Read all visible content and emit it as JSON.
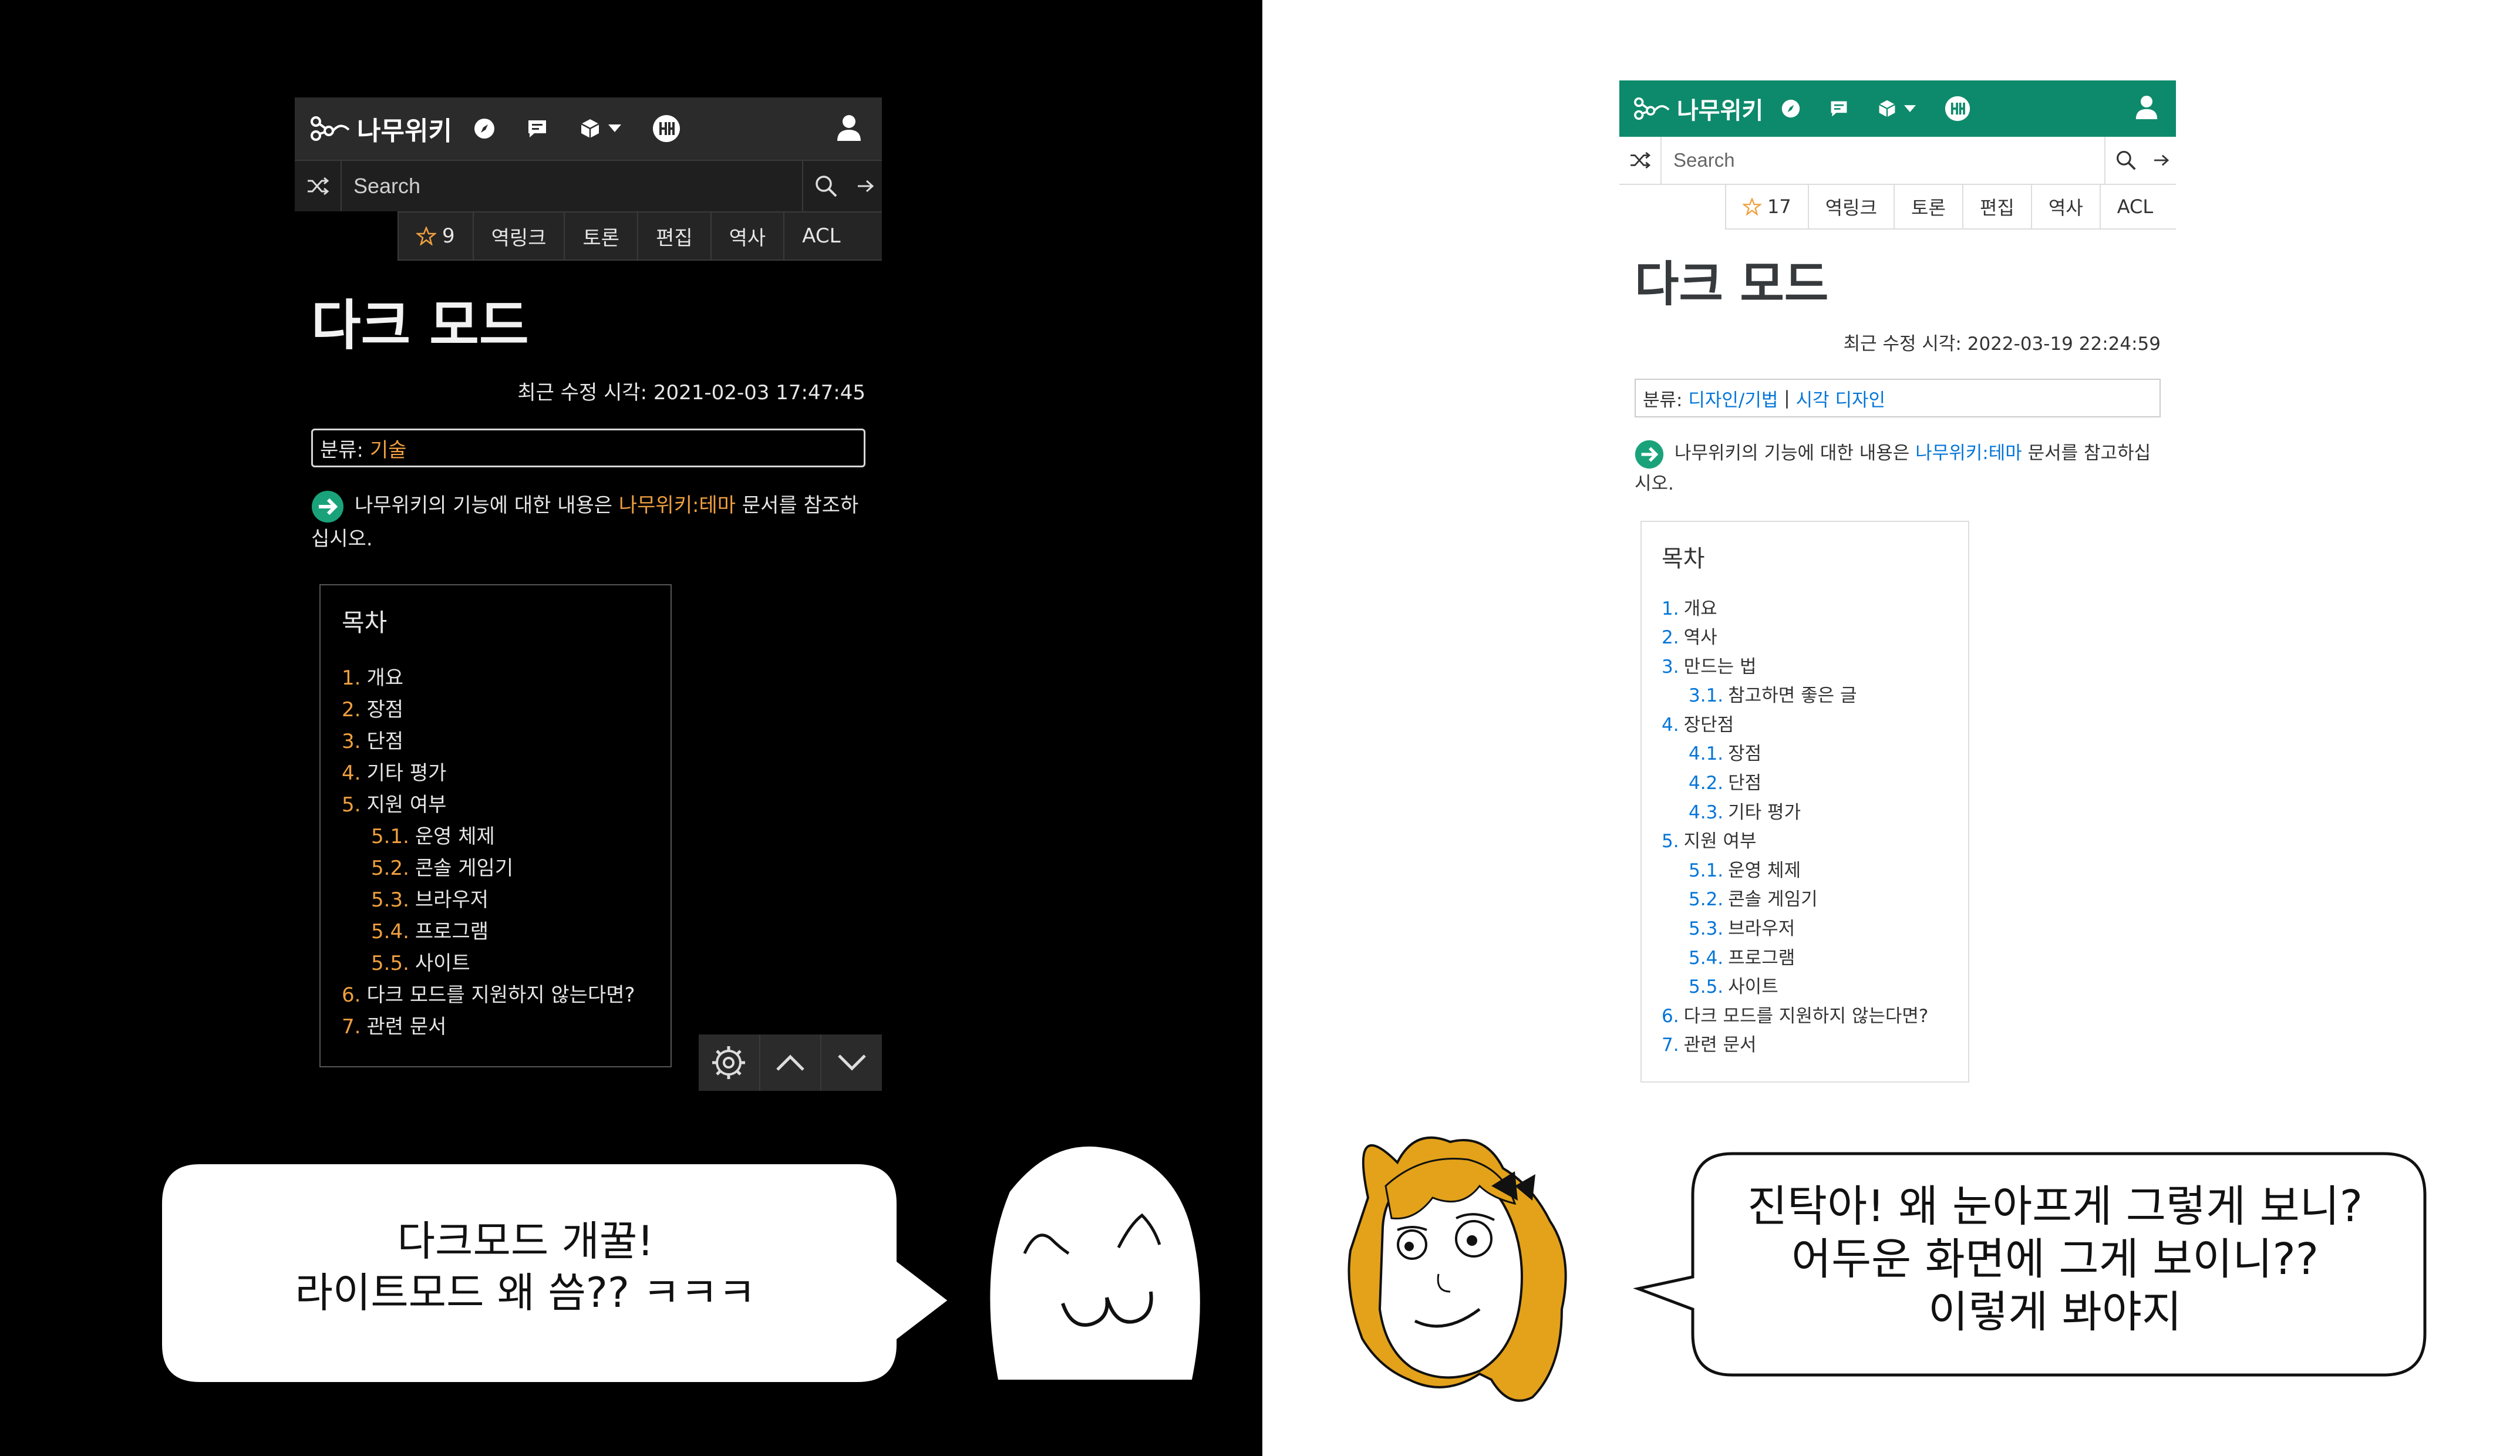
{
  "dark": {
    "logo_text": "나무위키",
    "search_placeholder": "Search",
    "tabs": {
      "star_count": "9",
      "backlinks": "역링크",
      "discuss": "토론",
      "edit": "편집",
      "history": "역사",
      "acl": "ACL"
    },
    "title": "다크 모드",
    "modified_label": "최근 수정 시각:",
    "modified_time": "2021-02-03 17:47:45",
    "category_label": "분류:",
    "category_value": "기술",
    "notice_before": "나무위키의 기능에 대한 내용은",
    "notice_link": "나무위키:테마",
    "notice_after": "문서를 참조하",
    "notice_line2": "십시오.",
    "toc_title": "목차",
    "toc": [
      {
        "num": "1.",
        "label": "개요",
        "sub": false
      },
      {
        "num": "2.",
        "label": "장점",
        "sub": false
      },
      {
        "num": "3.",
        "label": "단점",
        "sub": false
      },
      {
        "num": "4.",
        "label": "기타 평가",
        "sub": false
      },
      {
        "num": "5.",
        "label": "지원 여부",
        "sub": false
      },
      {
        "num": "5.1.",
        "label": "운영 체제",
        "sub": true
      },
      {
        "num": "5.2.",
        "label": "콘솔 게임기",
        "sub": true
      },
      {
        "num": "5.3.",
        "label": "브라우저",
        "sub": true
      },
      {
        "num": "5.4.",
        "label": "프로그램",
        "sub": true
      },
      {
        "num": "5.5.",
        "label": "사이트",
        "sub": true
      },
      {
        "num": "6.",
        "label": "다크 모드를 지원하지 않는다면?",
        "sub": false
      },
      {
        "num": "7.",
        "label": "관련 문서",
        "sub": false
      }
    ]
  },
  "light": {
    "logo_text": "나무위키",
    "search_placeholder": "Search",
    "tabs": {
      "star_count": "17",
      "backlinks": "역링크",
      "discuss": "토론",
      "edit": "편집",
      "history": "역사",
      "acl": "ACL"
    },
    "title": "다크 모드",
    "modified_label": "최근 수정 시각:",
    "modified_time": "2022-03-19 22:24:59",
    "category_label": "분류:",
    "category_value_1": "디자인/기법",
    "category_sep": "|",
    "category_value_2": "시각 디자인",
    "notice_before": "나무위키의 기능에 대한 내용은",
    "notice_link": "나무위키:테마",
    "notice_after": "문서를 참고하십",
    "notice_line2": "시오.",
    "toc_title": "목차",
    "toc": [
      {
        "num": "1.",
        "label": "개요",
        "sub": false
      },
      {
        "num": "2.",
        "label": "역사",
        "sub": false
      },
      {
        "num": "3.",
        "label": "만드는 법",
        "sub": false
      },
      {
        "num": "3.1.",
        "label": "참고하면 좋은 글",
        "sub": true
      },
      {
        "num": "4.",
        "label": "장단점",
        "sub": false
      },
      {
        "num": "4.1.",
        "label": "장점",
        "sub": true
      },
      {
        "num": "4.2.",
        "label": "단점",
        "sub": true
      },
      {
        "num": "4.3.",
        "label": "기타 평가",
        "sub": true
      },
      {
        "num": "5.",
        "label": "지원 여부",
        "sub": false
      },
      {
        "num": "5.1.",
        "label": "운영 체제",
        "sub": true
      },
      {
        "num": "5.2.",
        "label": "콘솔 게임기",
        "sub": true
      },
      {
        "num": "5.3.",
        "label": "브라우저",
        "sub": true
      },
      {
        "num": "5.4.",
        "label": "프로그램",
        "sub": true
      },
      {
        "num": "5.5.",
        "label": "사이트",
        "sub": true
      },
      {
        "num": "6.",
        "label": "다크 모드를 지원하지 않는다면?",
        "sub": false
      },
      {
        "num": "7.",
        "label": "관련 문서",
        "sub": false
      }
    ]
  },
  "bubbles": {
    "left_line1": "다크모드 개꿀!",
    "left_line2": "라이트모드 왜 씀?? ㅋㅋㅋ",
    "right_line1": "진탁아! 왜 눈아프게 그렇게 보니?",
    "right_line2": "어두운 화면에 그게 보이니??",
    "right_line3": "이렇게 봐야지"
  },
  "colors": {
    "dark_bg": "#000000",
    "dark_nav": "#2b2b2b",
    "dark_link": "#f0a040",
    "light_nav": "#0d8a6b",
    "light_link": "#0275d8",
    "arrow_badge": "#1aa37a",
    "star": "#f0a040"
  },
  "icons": [
    "namu-logo-icon",
    "compass-icon",
    "chat-icon",
    "cube-icon",
    "caret-down-icon",
    "theme-icon",
    "user-icon",
    "shuffle-icon",
    "search-icon",
    "go-arrow-icon",
    "star-icon",
    "arrow-right-circle-icon",
    "gear-icon",
    "chevron-up-icon",
    "chevron-down-icon"
  ]
}
